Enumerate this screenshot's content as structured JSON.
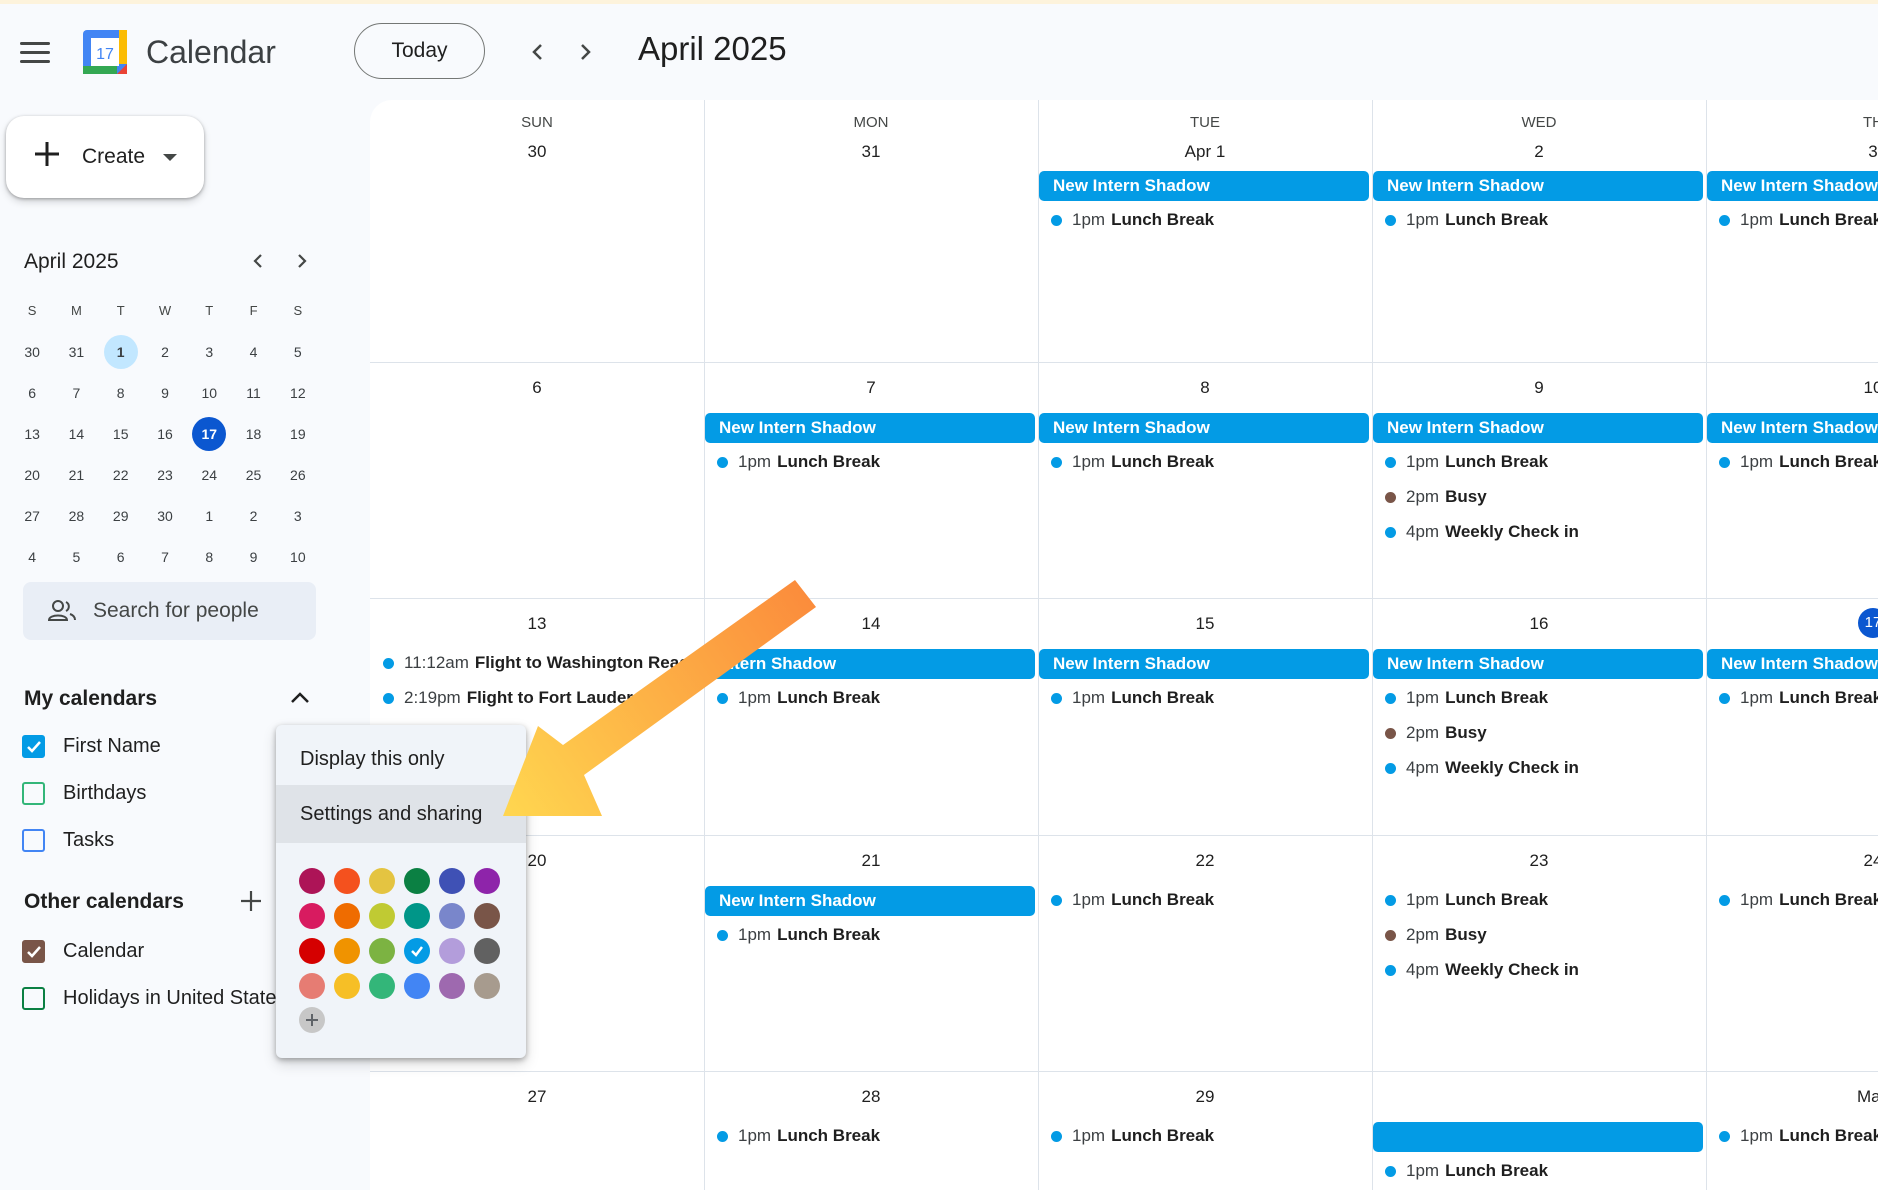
{
  "header": {
    "app_title": "Calendar",
    "logo_text": "17",
    "today_label": "Today",
    "month_title": "April 2025"
  },
  "sidebar": {
    "create_label": "Create",
    "mini_calendar": {
      "title": "April 2025",
      "weekdays": [
        "S",
        "M",
        "T",
        "W",
        "T",
        "F",
        "S"
      ],
      "weeks": [
        [
          "30",
          "31",
          "1",
          "2",
          "3",
          "4",
          "5"
        ],
        [
          "6",
          "7",
          "8",
          "9",
          "10",
          "11",
          "12"
        ],
        [
          "13",
          "14",
          "15",
          "16",
          "17",
          "18",
          "19"
        ],
        [
          "20",
          "21",
          "22",
          "23",
          "24",
          "25",
          "26"
        ],
        [
          "27",
          "28",
          "29",
          "30",
          "1",
          "2",
          "3"
        ],
        [
          "4",
          "5",
          "6",
          "7",
          "8",
          "9",
          "10"
        ]
      ],
      "highlighted_day": "1",
      "selected_day": "17"
    },
    "search_placeholder": "Search for people",
    "my_calendars": {
      "title": "My calendars",
      "items": [
        {
          "label": "First Name",
          "checked": true,
          "color": "#039be5"
        },
        {
          "label": "Birthdays",
          "checked": false,
          "color": "#33b679"
        },
        {
          "label": "Tasks",
          "checked": false,
          "color": "#4285f4"
        }
      ]
    },
    "other_calendars": {
      "title": "Other calendars",
      "items": [
        {
          "label": "Calendar",
          "checked": true,
          "color": "#795548"
        },
        {
          "label": "Holidays in United States",
          "checked": false,
          "color": "#0b8043"
        }
      ]
    }
  },
  "grid": {
    "day_names": [
      "SUN",
      "MON",
      "TUE",
      "WED",
      "TH"
    ],
    "weeks": [
      {
        "days": [
          {
            "num": "30",
            "events": []
          },
          {
            "num": "31",
            "events": []
          },
          {
            "num": "Apr 1",
            "events": [
              {
                "type": "chip",
                "label": "New Intern Shadow"
              },
              {
                "type": "dot",
                "time": "1pm",
                "name": "Lunch Break",
                "color": "#039be5"
              }
            ]
          },
          {
            "num": "2",
            "events": [
              {
                "type": "chip",
                "label": "New Intern Shadow"
              },
              {
                "type": "dot",
                "time": "1pm",
                "name": "Lunch Break",
                "color": "#039be5"
              }
            ]
          },
          {
            "num": "3",
            "events": [
              {
                "type": "chip",
                "label": "New Intern Shadow"
              },
              {
                "type": "dot",
                "time": "1pm",
                "name": "Lunch Break",
                "color": "#039be5"
              }
            ]
          }
        ]
      },
      {
        "days": [
          {
            "num": "6",
            "events": []
          },
          {
            "num": "7",
            "events": [
              {
                "type": "chip",
                "label": "New Intern Shadow"
              },
              {
                "type": "dot",
                "time": "1pm",
                "name": "Lunch Break",
                "color": "#039be5"
              }
            ]
          },
          {
            "num": "8",
            "events": [
              {
                "type": "chip",
                "label": "New Intern Shadow"
              },
              {
                "type": "dot",
                "time": "1pm",
                "name": "Lunch Break",
                "color": "#039be5"
              }
            ]
          },
          {
            "num": "9",
            "events": [
              {
                "type": "chip",
                "label": "New Intern Shadow"
              },
              {
                "type": "dot",
                "time": "1pm",
                "name": "Lunch Break",
                "color": "#039be5"
              },
              {
                "type": "dot",
                "time": "2pm",
                "name": "Busy",
                "color": "#795548"
              },
              {
                "type": "dot",
                "time": "4pm",
                "name": "Weekly Check in",
                "color": "#039be5"
              }
            ]
          },
          {
            "num": "10",
            "events": [
              {
                "type": "chip",
                "label": "New Intern Shadow"
              },
              {
                "type": "dot",
                "time": "1pm",
                "name": "Lunch Break",
                "color": "#039be5"
              }
            ]
          }
        ]
      },
      {
        "days": [
          {
            "num": "13",
            "events": [
              {
                "type": "dot",
                "time": "11:12am",
                "name": "Flight to Washington Reag",
                "color": "#039be5"
              },
              {
                "type": "dot",
                "time": "2:19pm",
                "name": "Flight to Fort Lauder",
                "color": "#039be5"
              }
            ]
          },
          {
            "num": "14",
            "events": [
              {
                "type": "chip",
                "label": "Intern Shadow"
              },
              {
                "type": "dot",
                "time": "1pm",
                "name": "Lunch Break",
                "color": "#039be5"
              }
            ]
          },
          {
            "num": "15",
            "events": [
              {
                "type": "chip",
                "label": "New Intern Shadow"
              },
              {
                "type": "dot",
                "time": "1pm",
                "name": "Lunch Break",
                "color": "#039be5"
              }
            ]
          },
          {
            "num": "16",
            "events": [
              {
                "type": "chip",
                "label": "New Intern Shadow"
              },
              {
                "type": "dot",
                "time": "1pm",
                "name": "Lunch Break",
                "color": "#039be5"
              },
              {
                "type": "dot",
                "time": "2pm",
                "name": "Busy",
                "color": "#795548"
              },
              {
                "type": "dot",
                "time": "4pm",
                "name": "Weekly Check in",
                "color": "#039be5"
              }
            ]
          },
          {
            "num": "17",
            "today": true,
            "events": [
              {
                "type": "chip",
                "label": "New Intern Shadow"
              },
              {
                "type": "dot",
                "time": "1pm",
                "name": "Lunch Break",
                "color": "#039be5"
              }
            ]
          }
        ]
      },
      {
        "days": [
          {
            "num": "20",
            "events": []
          },
          {
            "num": "21",
            "events": [
              {
                "type": "chip",
                "label": "New Intern Shadow"
              },
              {
                "type": "dot",
                "time": "1pm",
                "name": "Lunch Break",
                "color": "#039be5"
              }
            ]
          },
          {
            "num": "22",
            "events": [
              {
                "type": "dot",
                "time": "1pm",
                "name": "Lunch Break",
                "color": "#039be5"
              }
            ]
          },
          {
            "num": "23",
            "events": [
              {
                "type": "dot",
                "time": "1pm",
                "name": "Lunch Break",
                "color": "#039be5"
              },
              {
                "type": "dot",
                "time": "2pm",
                "name": "Busy",
                "color": "#795548"
              },
              {
                "type": "dot",
                "time": "4pm",
                "name": "Weekly Check in",
                "color": "#039be5"
              }
            ]
          },
          {
            "num": "24",
            "events": [
              {
                "type": "dot",
                "time": "1pm",
                "name": "Lunch Break",
                "color": "#039be5"
              }
            ]
          }
        ]
      },
      {
        "days": [
          {
            "num": "27",
            "events": []
          },
          {
            "num": "28",
            "events": [
              {
                "type": "dot",
                "time": "1pm",
                "name": "Lunch Break",
                "color": "#039be5"
              }
            ]
          },
          {
            "num": "29",
            "events": [
              {
                "type": "dot",
                "time": "1pm",
                "name": "Lunch Break",
                "color": "#039be5"
              }
            ]
          },
          {
            "num": "",
            "events": [
              {
                "type": "chip",
                "label": ""
              },
              {
                "type": "dot",
                "time": "1pm",
                "name": "Lunch Break",
                "color": "#039be5"
              }
            ]
          },
          {
            "num": "May",
            "events": [
              {
                "type": "dot",
                "time": "1pm",
                "name": "Lunch Break",
                "color": "#039be5"
              }
            ]
          }
        ]
      }
    ]
  },
  "popup": {
    "item_display_only": "Display this only",
    "item_settings": "Settings and sharing",
    "swatches": [
      [
        "#ad1457",
        "#f4511e",
        "#e4c441",
        "#0b8043",
        "#3f51b5",
        "#8e24aa"
      ],
      [
        "#d81b60",
        "#ef6c00",
        "#c0ca33",
        "#009688",
        "#7986cb",
        "#795548"
      ],
      [
        "#d50000",
        "#f09300",
        "#7cb342",
        "#039be5",
        "#b39ddb",
        "#616161"
      ],
      [
        "#e67c73",
        "#f6bf26",
        "#33b679",
        "#4285f4",
        "#9e69af",
        "#a79b8e"
      ]
    ],
    "selected_swatch": "#039be5"
  },
  "colors": {
    "event_blue": "#039be5",
    "today_blue": "#0b57d0",
    "arrow_start": "#fb8c3c",
    "arrow_end": "#ffd54f"
  }
}
